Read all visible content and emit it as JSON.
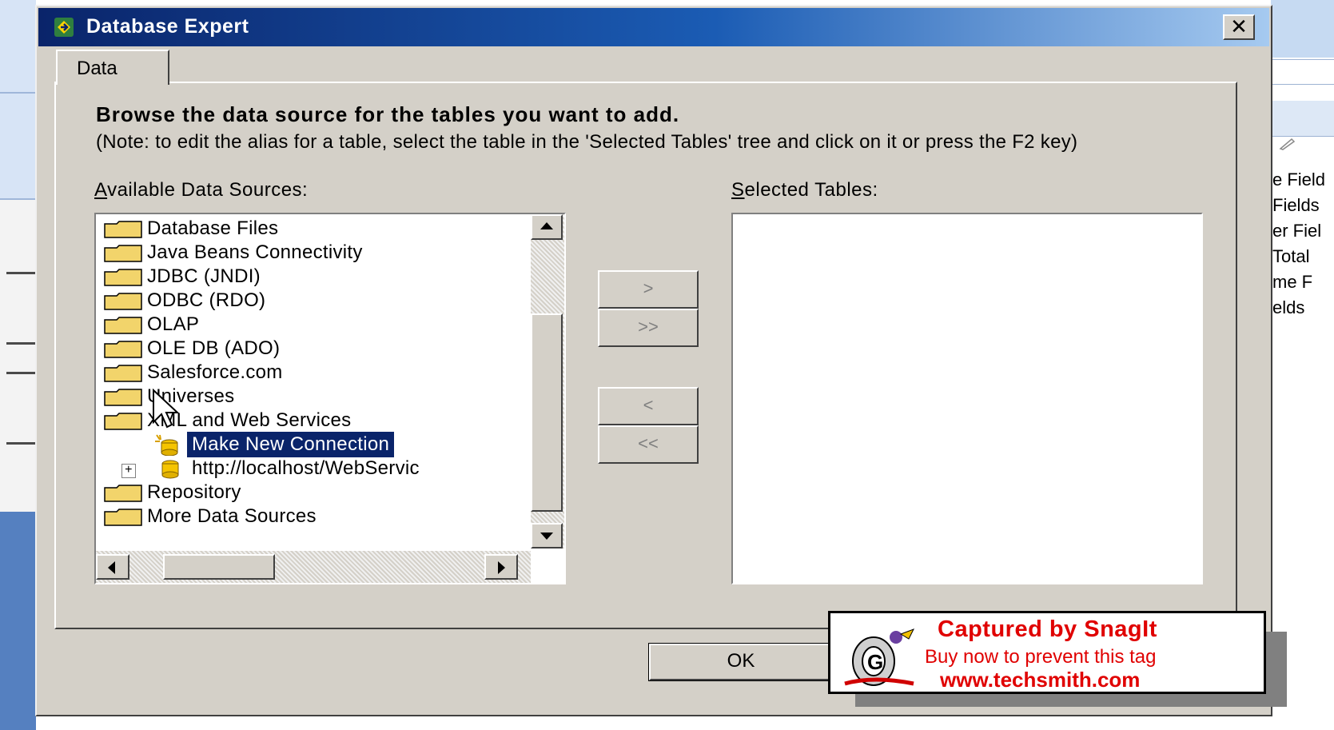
{
  "window": {
    "title": "Database Expert",
    "close_label": "✕"
  },
  "tabs": [
    {
      "label": "Data"
    }
  ],
  "instructions": {
    "heading": "Browse the data source for the tables you want to add.",
    "note": "(Note: to edit the alias for a table, select the table in the 'Selected Tables' tree and click on it or press the F2 key)"
  },
  "available": {
    "label_accel": "A",
    "label_rest": "vailable Data Sources:",
    "items": [
      {
        "label": "Database Files",
        "type": "folder"
      },
      {
        "label": "Java Beans Connectivity",
        "type": "folder"
      },
      {
        "label": "JDBC (JNDI)",
        "type": "folder"
      },
      {
        "label": "ODBC (RDO)",
        "type": "folder"
      },
      {
        "label": "OLAP",
        "type": "folder"
      },
      {
        "label": "OLE DB (ADO)",
        "type": "folder"
      },
      {
        "label": "Salesforce.com",
        "type": "folder"
      },
      {
        "label": "Universes",
        "type": "folder"
      },
      {
        "label": "XML and Web Services",
        "type": "folder"
      },
      {
        "label": "Make New Connection",
        "type": "new-connection",
        "selected": true
      },
      {
        "label": "http://localhost/WebServic",
        "type": "connection"
      },
      {
        "label": "Repository",
        "type": "folder"
      },
      {
        "label": "More Data Sources",
        "type": "folder"
      }
    ]
  },
  "selected": {
    "label_accel": "S",
    "label_rest": "elected Tables:"
  },
  "move_buttons": {
    "add_one": ">",
    "add_all": ">>",
    "remove_one": "<",
    "remove_all": "<<"
  },
  "footer": {
    "ok_label": "OK"
  },
  "snagit": {
    "line1": "Captured by SnagIt",
    "line2": "Buy now to prevent this tag",
    "line3": "www.techsmith.com"
  },
  "background_app": {
    "right_items": [
      "e Field",
      "Fields",
      "er Fiel",
      "Total",
      "me F",
      "elds"
    ]
  },
  "colors": {
    "title_bar": "#0a246a",
    "selection": "#0a246a",
    "dialog_face": "#d4d0c8",
    "snagit_text": "#e00000"
  }
}
